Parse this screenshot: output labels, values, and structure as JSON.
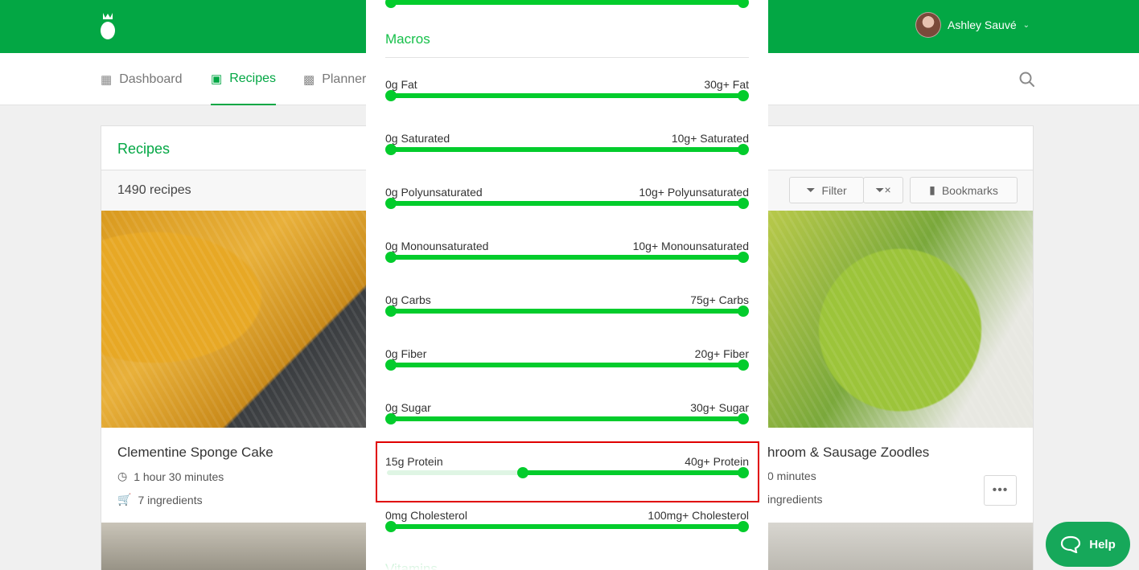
{
  "user": {
    "name": "Ashley Sauvé"
  },
  "nav": {
    "items": [
      {
        "label": "Dashboard",
        "icon": "dashboard-icon"
      },
      {
        "label": "Recipes",
        "icon": "inbox-tray-icon",
        "active": true
      },
      {
        "label": "Planner",
        "icon": "calendar-icon"
      }
    ]
  },
  "recipes": {
    "title": "Recipes",
    "count": "1490 recipes",
    "filter_label": "Filter",
    "bookmarks_label": "Bookmarks",
    "cards": [
      {
        "title": "Clementine Sponge Cake",
        "time": "1 hour 30 minutes",
        "ingredients": "7 ingredients"
      },
      {
        "title": "hroom & Sausage Zoodles",
        "time": "0 minutes",
        "ingredients": "ingredients"
      }
    ]
  },
  "modal": {
    "macros_title": "Macros",
    "vitamins_title": "Vitamins",
    "sliders": [
      {
        "min_label": "0g Fat",
        "max_label": "30g+ Fat",
        "low": 0,
        "high": 1
      },
      {
        "min_label": "0g Saturated",
        "max_label": "10g+ Saturated",
        "low": 0,
        "high": 1
      },
      {
        "min_label": "0g Polyunsaturated",
        "max_label": "10g+ Polyunsaturated",
        "low": 0,
        "high": 1
      },
      {
        "min_label": "0g Monounsaturated",
        "max_label": "10g+ Monounsaturated",
        "low": 0,
        "high": 1
      },
      {
        "min_label": "0g Carbs",
        "max_label": "75g+ Carbs",
        "low": 0,
        "high": 1
      },
      {
        "min_label": "0g Fiber",
        "max_label": "20g+ Fiber",
        "low": 0,
        "high": 1
      },
      {
        "min_label": "0g Sugar",
        "max_label": "30g+ Sugar",
        "low": 0,
        "high": 1
      },
      {
        "min_label": "15g Protein",
        "max_label": "40g+ Protein",
        "low": 0.375,
        "high": 1
      },
      {
        "min_label": "0mg Cholesterol",
        "max_label": "100mg+ Cholesterol",
        "low": 0,
        "high": 1
      }
    ]
  },
  "help": {
    "label": "Help"
  },
  "colors": {
    "brand": "#03a744",
    "slider": "#03cc2c",
    "highlight": "#e00000"
  }
}
